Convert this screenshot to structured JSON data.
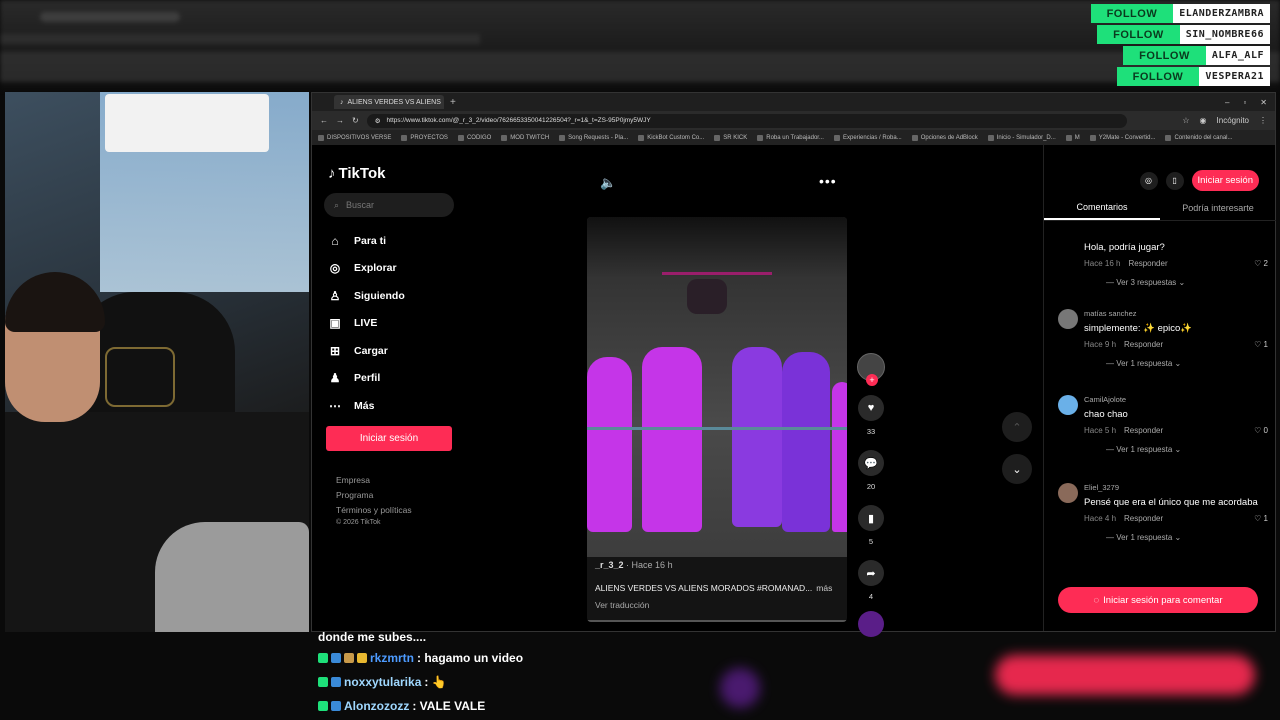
{
  "alerts": [
    {
      "action": "FOLLOW",
      "name": "ELANDERZAMBRA"
    },
    {
      "action": "FOLLOW",
      "name": "SIN_NOMBRE66"
    },
    {
      "action": "FOLLOW",
      "name": "ALFA_ALF"
    },
    {
      "action": "FOLLOW",
      "name": "VESPERA21"
    }
  ],
  "browser": {
    "tab_title": "ALIENS VERDES VS ALIENS",
    "url": "https://www.tiktok.com/@_r_3_2/video/7626653350041226504?_r=1&_t=ZS-95P0jmy5WJY",
    "incognito_label": "Incógnito",
    "bookmarks": [
      "DISPOSITIVOS VERSE",
      "PROYECTOS",
      "CODIGO",
      "MOD TWITCH",
      "Song Requests - Pla...",
      "KickBot Custom Co...",
      "SR KICK",
      "Roba un Trabajador...",
      "Experiencias / Roba...",
      "Opciones de AdBlock",
      "Inicio - Simulador_D...",
      "M",
      "Y2Mate - Convertid...",
      "Contenido del canal..."
    ]
  },
  "tiktok": {
    "logo": "TikTok",
    "search_placeholder": "Buscar",
    "nav": [
      {
        "label": "Para ti",
        "icon": "home-icon"
      },
      {
        "label": "Explorar",
        "icon": "compass-icon"
      },
      {
        "label": "Siguiendo",
        "icon": "following-icon"
      },
      {
        "label": "LIVE",
        "icon": "live-icon"
      },
      {
        "label": "Cargar",
        "icon": "upload-icon"
      },
      {
        "label": "Perfil",
        "icon": "profile-icon"
      },
      {
        "label": "Más",
        "icon": "more-icon"
      }
    ],
    "login_button": "Iniciar sesión",
    "footer": [
      "Empresa",
      "Programa",
      "Términos y políticas"
    ],
    "copyright": "© 2026 TikTok",
    "video": {
      "author": "_r_3_2",
      "time": "· Hace 16 h",
      "description": "ALIENS VERDES VS ALIENS MORADOS #ROMANAD...",
      "more": "más",
      "translate": "Ver traducción",
      "likes": "33",
      "comments": "20",
      "saves": "5",
      "shares": "4"
    },
    "panel": {
      "login_button": "Iniciar sesión",
      "tabs": [
        "Comentarios",
        "Podría interesarte"
      ],
      "comments": [
        {
          "user": "",
          "text": "Hola, podría jugar?",
          "time": "Hace 16 h",
          "reply": "Responder",
          "likes": "2",
          "replies": "Ver 3 respuestas"
        },
        {
          "user": "matías sanchez",
          "text": "simplemente: ✨ epico✨",
          "time": "Hace 9 h",
          "reply": "Responder",
          "likes": "1",
          "replies": "Ver 1 respuesta"
        },
        {
          "user": "CamilAjolote",
          "text": "chao chao",
          "time": "Hace 5 h",
          "reply": "Responder",
          "likes": "0",
          "replies": "Ver 1 respuesta"
        },
        {
          "user": "Eliel_3279",
          "text": "Pensé que era el único que me acordaba",
          "time": "Hace 4 h",
          "reply": "Responder",
          "likes": "1",
          "replies": "Ver 1 respuesta"
        }
      ],
      "comment_button": "Iniciar sesión para comentar"
    }
  },
  "chat": [
    {
      "user": "",
      "message": "donde me subes...."
    },
    {
      "user": "rkzmrtn",
      "message": ": hagamo un video"
    },
    {
      "user": "noxxytularika",
      "message": ": 👆"
    },
    {
      "user": "Alonzozozz",
      "message": ": VALE VALE"
    }
  ],
  "colors": {
    "tiktok_red": "#fe2c55",
    "follow_green": "#1ee07a",
    "chat_name": "#4d9bff"
  }
}
